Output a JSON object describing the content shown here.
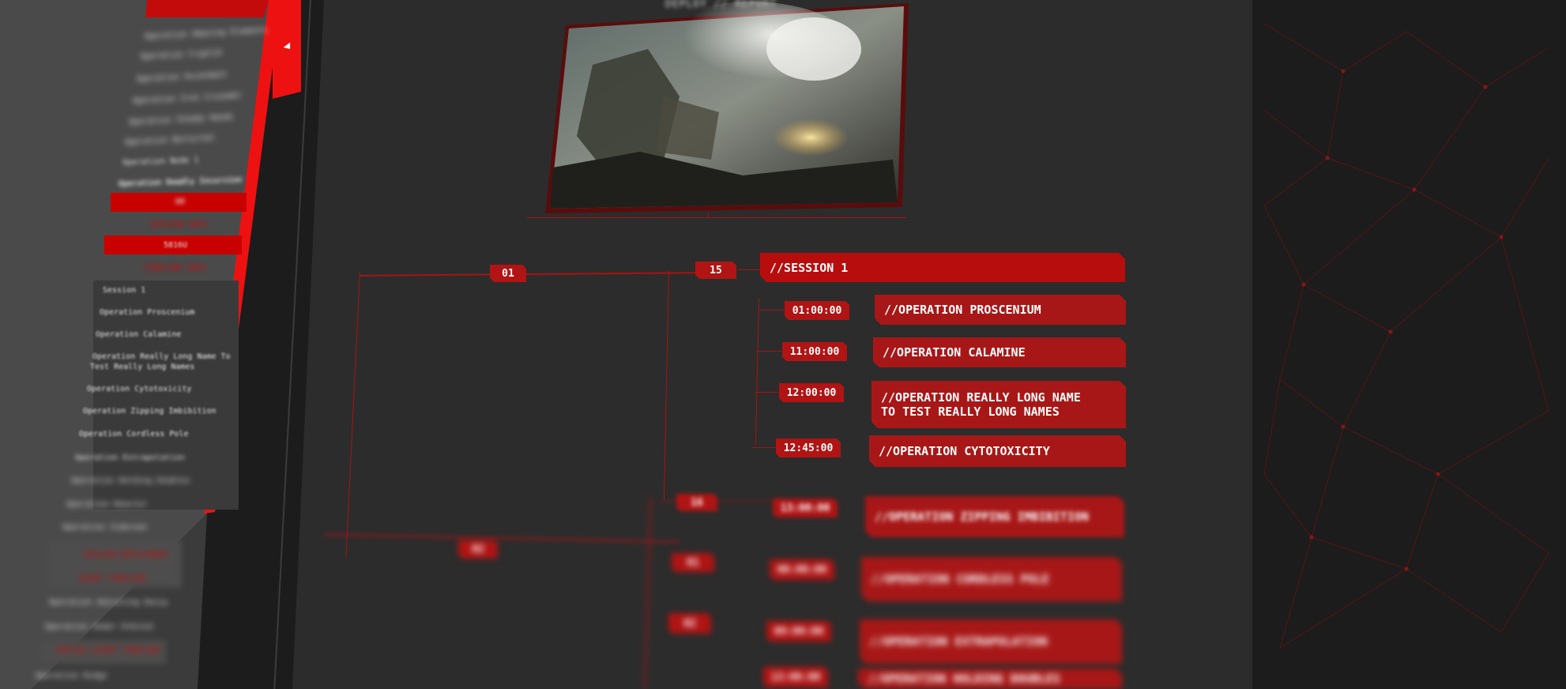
{
  "hero": {
    "title": "DEPLOY // REPORT",
    "image_alt": "battle scene with smoke and explosion"
  },
  "sidebar": {
    "collapse_icon": "chevron-left-icon",
    "top_items": [
      "Operation Amazing Elements",
      "Operation Cryptid",
      "Operation Ascendant",
      "Operation Iron Crusader",
      "Operation Steady Hands",
      "Operation Nocturnal",
      "Operation Node 1",
      "Operation Deadly Incursion"
    ],
    "band_1": "UV",
    "band_2": "5816U",
    "band_2_sub_a": "SESSION INFO",
    "band_2_sub_b": "TIMELINE INFO",
    "session_items": [
      "Session 1",
      "Operation Proscenium",
      "Operation Calamine",
      "Operation Really Long Name To",
      "Test Really Long Names",
      "Operation Cytotoxicity",
      "Operation Zipping Imbibition",
      "Operation Cordless Pole",
      "Operation Extrapolation",
      "Operation Holding Doubles",
      "Operation Reactor",
      "Operation Sidereal"
    ],
    "lower_red": [
      "SESSION DEPLOYMENT",
      "EVENT TIMELINE"
    ],
    "lower_items": [
      "Operation Adjusting Daisy",
      "Operation Under Orbital"
    ],
    "lower_red_2": "SPECIAL EVENT TIMELINE",
    "last_item": "Operation Ridge"
  },
  "tree": {
    "day_1": "01",
    "day_2": "02",
    "session_1_num": "15",
    "session_1_label": "//SESSION 1",
    "ops": [
      {
        "time": "01:00:00",
        "label": "//OPERATION PROSCENIUM"
      },
      {
        "time": "11:00:00",
        "label": "//OPERATION CALAMINE"
      },
      {
        "time": "12:00:00",
        "label_line1": "//OPERATION REALLY LONG NAME",
        "label_line2": "TO TEST REALLY LONG NAMES"
      },
      {
        "time": "12:45:00",
        "label": "//OPERATION CYTOTOXICITY"
      }
    ],
    "blurred": [
      {
        "num": "16",
        "time": "13:00:00",
        "label": "//OPERATION ZIPPING IMBIBITION"
      },
      {
        "num": "01",
        "time": "00:00:00",
        "label": "//OPERATION CORDLESS POLE"
      },
      {
        "num": "02",
        "time": "09:00:00",
        "label": "//OPERATION EXTRAPOLATION"
      },
      {
        "time": "13:00:00",
        "label": "//OPERATION HOLDING DOUBLES"
      }
    ]
  },
  "colors": {
    "accent": "#b01414",
    "bright_red": "#ee1111",
    "panel": "#2c2c2c",
    "background": "#1c1c1c"
  }
}
